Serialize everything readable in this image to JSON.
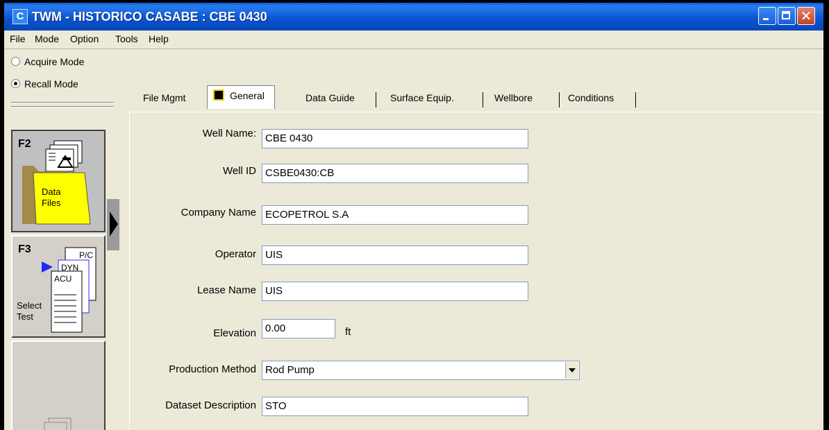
{
  "window": {
    "app_icon_letter": "C",
    "title": "TWM  -  HISTORICO CASABE : CBE 0430",
    "close_glyph": "✕"
  },
  "menu": [
    "File",
    "Mode",
    "Option",
    "Tools",
    "Help"
  ],
  "mode": {
    "acquire_label": "Acquire Mode",
    "recall_label": "Recall Mode",
    "selected": "Recall Mode"
  },
  "fkeys": {
    "f2": {
      "key": "F2",
      "caption_line1": "Data",
      "caption_line2": "Files"
    },
    "f3": {
      "key": "F3",
      "caption_line1": "Select",
      "caption_line2": "Test",
      "doc_labels": [
        "P/C",
        "DYN",
        "ACU"
      ]
    }
  },
  "tabs": [
    "File Mgmt",
    "General",
    "Data Guide",
    "Surface Equip.",
    "Wellbore",
    "Conditions"
  ],
  "active_tab": "General",
  "form": {
    "well_name": {
      "label": "Well Name:",
      "value": "CBE 0430"
    },
    "well_id": {
      "label": "Well ID",
      "value": "CSBE0430:CB"
    },
    "company_name": {
      "label": "Company Name",
      "value": "ECOPETROL S.A"
    },
    "operator": {
      "label": "Operator",
      "value": "UIS"
    },
    "lease_name": {
      "label": "Lease Name",
      "value": "UIS"
    },
    "elevation": {
      "label": "Elevation",
      "value": "0.00",
      "unit": "ft"
    },
    "production_method": {
      "label": "Production Method",
      "value": "Rod Pump"
    },
    "dataset_description": {
      "label": "Dataset Description",
      "value": "STO"
    }
  }
}
